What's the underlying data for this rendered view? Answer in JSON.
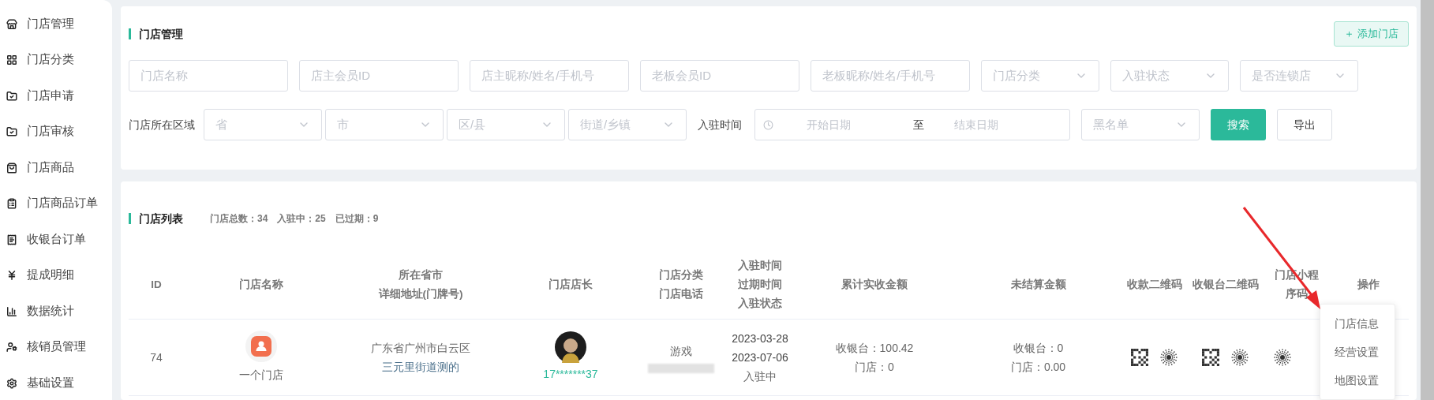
{
  "sidebar": {
    "items": [
      {
        "label": "门店管理"
      },
      {
        "label": "门店分类"
      },
      {
        "label": "门店申请"
      },
      {
        "label": "门店审核"
      },
      {
        "label": "门店商品"
      },
      {
        "label": "门店商品订单"
      },
      {
        "label": "收银台订单"
      },
      {
        "label": "提成明细"
      },
      {
        "label": "数据统计"
      },
      {
        "label": "核销员管理"
      },
      {
        "label": "基础设置"
      }
    ]
  },
  "filter_panel": {
    "title": "门店管理",
    "add_button": "＋ 添加门店",
    "row1": [
      {
        "kind": "input",
        "placeholder": "门店名称"
      },
      {
        "kind": "input",
        "placeholder": "店主会员ID"
      },
      {
        "kind": "input",
        "placeholder": "店主昵称/姓名/手机号"
      },
      {
        "kind": "input",
        "placeholder": "老板会员ID"
      },
      {
        "kind": "input",
        "placeholder": "老板昵称/姓名/手机号"
      },
      {
        "kind": "select",
        "placeholder": "门店分类"
      },
      {
        "kind": "select",
        "placeholder": "入驻状态"
      },
      {
        "kind": "select",
        "placeholder": "是否连锁店"
      }
    ],
    "region_label": "门店所在区域",
    "region_selects": [
      {
        "placeholder": "省"
      },
      {
        "placeholder": "市"
      },
      {
        "placeholder": "区/县"
      },
      {
        "placeholder": "街道/乡镇"
      }
    ],
    "date_label": "入驻时间",
    "date_range": {
      "start_placeholder": "开始日期",
      "separator": "至",
      "end_placeholder": "结束日期"
    },
    "blacklist_select": {
      "placeholder": "黑名单"
    },
    "search_button": "搜索",
    "export_button": "导出"
  },
  "list_panel": {
    "title": "门店列表",
    "stats": [
      "门店总数：34",
      "入驻中：25",
      "已过期：9"
    ],
    "table": {
      "columns": [
        [
          "ID"
        ],
        [
          "门店名称"
        ],
        [
          "所在省市",
          "详细地址(门牌号)"
        ],
        [
          "门店店长"
        ],
        [
          "门店分类",
          "门店电话"
        ],
        [
          "入驻时间",
          "过期时间",
          "入驻状态"
        ],
        [
          "累计实收金额"
        ],
        [
          "未结算金额"
        ],
        [
          "收款二维码"
        ],
        [
          "收银台二维码"
        ],
        [
          "门店小程",
          "序码"
        ],
        [
          "操作"
        ]
      ],
      "rows": [
        {
          "id": "74",
          "store_name": "一个门店",
          "address": [
            "广东省广州市白云区",
            "三元里街道测的"
          ],
          "owner_phone": "17*******37",
          "category": "游戏",
          "dates": [
            "2023-03-28",
            "2023-07-06",
            "入驻中"
          ],
          "received": [
            "收银台：100.42",
            "门店：0"
          ],
          "unsettled": [
            "收银台：0",
            "门店：0.00"
          ]
        }
      ]
    },
    "action_menu": {
      "items": [
        "门店信息",
        "经营设置",
        "地图设置"
      ]
    }
  }
}
